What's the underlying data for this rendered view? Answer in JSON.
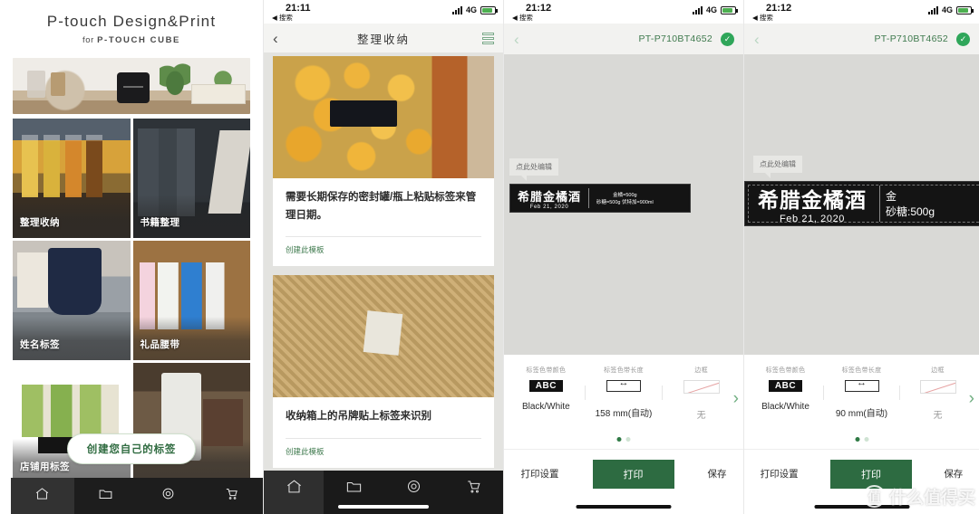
{
  "panel1": {
    "title": "P-touch Design&Print",
    "subtitle_prefix": "for",
    "subtitle_brand": "P-TOUCH CUBE",
    "categories": [
      {
        "label": "整理收纳"
      },
      {
        "label": "书籍整理"
      },
      {
        "label": "姓名标签"
      },
      {
        "label": "礼品腰带"
      },
      {
        "label": "店铺用标签"
      },
      {
        "label": ""
      }
    ],
    "cta_label": "创建您自己的标签",
    "nav": [
      {
        "name": "home-icon",
        "active": true
      },
      {
        "name": "folder-icon",
        "active": false
      },
      {
        "name": "gear-icon",
        "active": false
      },
      {
        "name": "cart-icon",
        "active": false
      }
    ]
  },
  "panel2": {
    "status": {
      "time": "21:11",
      "back_label": "搜索",
      "network": "4G"
    },
    "header": {
      "title": "整理收纳",
      "back_icon": "chevron-left-icon",
      "menu_icon": "list-menu-icon"
    },
    "cards": [
      {
        "text": "需要长期保存的密封罐/瓶上粘贴标签来管理日期。",
        "link": "创建此模板"
      },
      {
        "text": "收纳箱上的吊牌贴上标签来识别",
        "link": "创建此模板"
      }
    ],
    "nav": [
      {
        "name": "home-icon",
        "active": true
      },
      {
        "name": "folder-icon",
        "active": false
      },
      {
        "name": "gear-icon",
        "active": false
      },
      {
        "name": "cart-icon",
        "active": false
      }
    ]
  },
  "panel3": {
    "status": {
      "time": "21:12",
      "back_label": "搜索",
      "network": "4G"
    },
    "header": {
      "device": "PT-P710BT4652",
      "connected_icon": "check-circle-icon"
    },
    "tooltip": "点此处编辑",
    "label": {
      "title": "希腊金橘酒",
      "date": "Feb 21, 2020",
      "line1": "金橘=500g",
      "line2": "砂糖=500g  伏特加=900ml"
    },
    "settings": [
      {
        "title": "标签色带颜色",
        "value": "Black/White",
        "swatch": "abc-swatch"
      },
      {
        "title": "标签色带长度",
        "value": "158 mm(自动)",
        "swatch": "length-swatch"
      },
      {
        "title": "边框",
        "value": "无",
        "swatch": "border-swatch"
      }
    ],
    "pager": {
      "total": 2,
      "active": 0
    },
    "actions": {
      "settings": "打印设置",
      "print": "打印",
      "save": "保存"
    }
  },
  "panel4": {
    "status": {
      "time": "21:12",
      "back_label": "搜索",
      "network": "4G"
    },
    "header": {
      "device": "PT-P710BT4652",
      "connected_icon": "check-circle-icon"
    },
    "tooltip": "点此处编辑",
    "label": {
      "title": "希腊金橘酒",
      "date": "Feb 21, 2020",
      "line1": "金",
      "line2": "砂糖:500g"
    },
    "settings": [
      {
        "title": "标签色带颜色",
        "value": "Black/White",
        "swatch": "abc-swatch"
      },
      {
        "title": "标签色带长度",
        "value": "90 mm(自动)",
        "swatch": "length-swatch"
      },
      {
        "title": "边框",
        "value": "无",
        "swatch": "border-swatch"
      }
    ],
    "pager": {
      "total": 2,
      "active": 0
    },
    "actions": {
      "settings": "打印设置",
      "print": "打印",
      "save": "保存"
    }
  },
  "watermark": {
    "logo": "值",
    "text": "什么值得买"
  },
  "colors": {
    "accent_green": "#2d6b41",
    "link_green": "#3f7a4e",
    "nav_dark": "#1a1a1a"
  }
}
